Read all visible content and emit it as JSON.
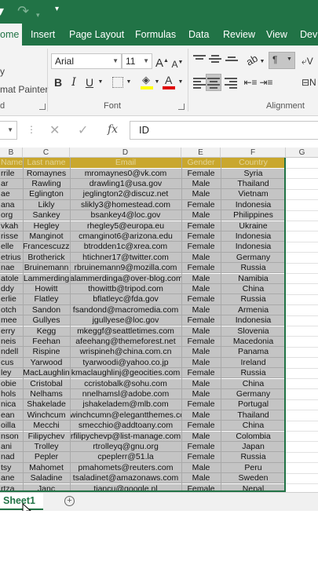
{
  "ribbon": {
    "tabs": [
      "ome",
      "Insert",
      "Page Layout",
      "Formulas",
      "Data",
      "Review",
      "View",
      "Dev"
    ],
    "active_tab": "ome",
    "clipboard": {
      "format_painter": "mat Painter",
      "fragment_top": "y",
      "group_label": "d"
    },
    "font": {
      "name": "Arial",
      "size": "11",
      "group_label": "Font",
      "grow": "A",
      "shrink": "A",
      "bold": "B",
      "italic": "I",
      "underline": "U",
      "font_color_letter": "A"
    },
    "alignment": {
      "group_label": "Alignment"
    }
  },
  "colors": {
    "excel_green": "#217346",
    "header_fill": "#c9a72e",
    "header_text": "#e3d59a",
    "selection_gray": "#c4c4c4",
    "highlight_yellow": "#ffff00",
    "font_red": "#e00000"
  },
  "formula_bar": {
    "fx_label": "fx",
    "value": "ID"
  },
  "columns": [
    "B",
    "C",
    "D",
    "E",
    "F",
    "G"
  ],
  "headers": [
    "Name",
    "Last name",
    "Email",
    "Gender",
    "Country"
  ],
  "rows": [
    [
      "rrile",
      "Romaynes",
      "mromaynes0@vk.com",
      "Female",
      "Syria"
    ],
    [
      "ar",
      "Rawling",
      "drawling1@usa.gov",
      "Male",
      "Thailand"
    ],
    [
      "ae",
      "Eglington",
      "jeglington2@discuz.net",
      "Male",
      "Vietnam"
    ],
    [
      "ana",
      "Likly",
      "slikly3@homestead.com",
      "Female",
      "Indonesia"
    ],
    [
      "org",
      "Sankey",
      "bsankey4@loc.gov",
      "Male",
      "Philippines"
    ],
    [
      "vkah",
      "Hegley",
      "rhegley5@europa.eu",
      "Female",
      "Ukraine"
    ],
    [
      "risse",
      "Manginot",
      "cmanginot6@arizona.edu",
      "Female",
      "Indonesia"
    ],
    [
      "elle",
      "Francescuzzi",
      "btrodden1c@xrea.com",
      "Female",
      "Indonesia"
    ],
    [
      "etrius",
      "Brotherick",
      "htichner17@twitter.com",
      "Male",
      "Germany"
    ],
    [
      "nae",
      "Bruinemann",
      "rbruinemann9@mozilla.com",
      "Female",
      "Russia"
    ],
    [
      "atole",
      "Lammerding",
      "alammerdinga@over-blog.com",
      "Male",
      "Namibia"
    ],
    [
      "ddy",
      "Howitt",
      "thowittb@tripod.com",
      "Male",
      "China"
    ],
    [
      "erlie",
      "Flatley",
      "bflatleyc@fda.gov",
      "Female",
      "Russia"
    ],
    [
      "otch",
      "Sandon",
      "fsandond@macromedia.com",
      "Male",
      "Armenia"
    ],
    [
      "mee",
      "Gullyes",
      "jgullyese@loc.gov",
      "Female",
      "Indonesia"
    ],
    [
      "erry",
      "Kegg",
      "mkeggf@seattletimes.com",
      "Male",
      "Slovenia"
    ],
    [
      "neis",
      "Feehan",
      "afeehang@themeforest.net",
      "Female",
      "Macedonia"
    ],
    [
      "ndell",
      "Rispine",
      "wrispineh@china.com.cn",
      "Male",
      "Panama"
    ],
    [
      "cus",
      "Yarwood",
      "tyarwoodi@yahoo.co.jp",
      "Male",
      "Ireland"
    ],
    [
      "ley",
      "MacLaughlin",
      "kmaclaughlinj@geocities.com",
      "Female",
      "Russia"
    ],
    [
      "obie",
      "Cristobal",
      "ccristobalk@sohu.com",
      "Male",
      "China"
    ],
    [
      "hols",
      "Nelhams",
      "nnelhamsl@adobe.com",
      "Male",
      "Germany"
    ],
    [
      "nica",
      "Shakelade",
      "jshakeladem@mlb.com",
      "Female",
      "Portugal"
    ],
    [
      "ean",
      "Winchcum",
      "winchcumn@elegantthemes.com",
      "Male",
      "Thailand"
    ],
    [
      "oilla",
      "Mecchi",
      "smecchio@addtoany.com",
      "Female",
      "China"
    ],
    [
      "nson",
      "Filipychev",
      "rfilipychevp@list-manage.com",
      "Male",
      "Colombia"
    ],
    [
      "ani",
      "Trolley",
      "rtrolleyq@gnu.org",
      "Female",
      "Japan"
    ],
    [
      "nad",
      "Pepler",
      "cpeplerr@51.la",
      "Female",
      "Russia"
    ],
    [
      "tsy",
      "Mahomet",
      "pmahomets@reuters.com",
      "Male",
      "Peru"
    ],
    [
      "ane",
      "Saladine",
      "tsaladinet@amazonaws.com",
      "Male",
      "Sweden"
    ],
    [
      "rtza",
      "Janc",
      "tjancu@google.nl",
      "Female",
      "Nepal"
    ]
  ],
  "sheets": [
    "Sheet1"
  ],
  "add_sheet": "+"
}
